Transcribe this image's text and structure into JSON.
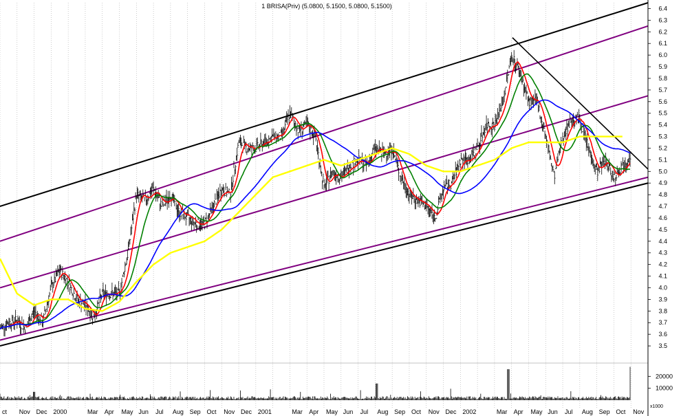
{
  "chart_data": {
    "type": "line",
    "title": "1 BRISA(Priv) (5.0800, 5.1500, 5.0800, 5.1500)",
    "ylim": [
      3.4,
      6.45
    ],
    "y_ticks": [
      "3.5",
      "3.6",
      "3.7",
      "3.8",
      "3.9",
      "4.0",
      "4.1",
      "4.2",
      "4.3",
      "4.4",
      "4.5",
      "4.6",
      "4.7",
      "4.8",
      "4.9",
      "5.0",
      "5.1",
      "5.2",
      "5.3",
      "5.4",
      "5.5",
      "5.6",
      "5.7",
      "5.8",
      "5.9",
      "6.0",
      "6.1",
      "6.2",
      "6.3",
      "6.4"
    ],
    "x_labels": [
      "ct",
      "Nov",
      "Dec",
      "2000",
      "Mar",
      "Apr",
      "May",
      "Jun",
      "Jul",
      "Aug",
      "Sep",
      "Oct",
      "Nov",
      "Dec",
      "2001",
      "Mar",
      "Apr",
      "May",
      "Jun",
      "Jul",
      "Aug",
      "Sep",
      "Oct",
      "Nov",
      "Dec",
      "2002",
      "Mar",
      "Apr",
      "May",
      "Jun",
      "Jul",
      "Aug",
      "Sep",
      "Oct",
      "Nov"
    ],
    "x_label_months": [
      0,
      1,
      2,
      3,
      5,
      6,
      7,
      8,
      9,
      10,
      11,
      12,
      13,
      14,
      15,
      17,
      18,
      19,
      20,
      21,
      22,
      23,
      24,
      25,
      26,
      27,
      29,
      30,
      31,
      32,
      33,
      34,
      35,
      36,
      37
    ],
    "months_total": 38,
    "volume_ticks": [
      "20000",
      "10000"
    ],
    "volume_unit": "x1000",
    "volume_ylim": [
      0,
      30000
    ],
    "price_anchors": [
      [
        0,
        3.65
      ],
      [
        0.5,
        3.7
      ],
      [
        1,
        3.72
      ],
      [
        1.5,
        3.65
      ],
      [
        2,
        3.8
      ],
      [
        2.5,
        3.7
      ],
      [
        3,
        4.0
      ],
      [
        3.5,
        4.15
      ],
      [
        4,
        4.05
      ],
      [
        4.5,
        3.9
      ],
      [
        5,
        3.85
      ],
      [
        5.5,
        3.75
      ],
      [
        6,
        3.95
      ],
      [
        6.5,
        3.95
      ],
      [
        7,
        3.95
      ],
      [
        7.5,
        4.3
      ],
      [
        8,
        4.8
      ],
      [
        8.5,
        4.75
      ],
      [
        9,
        4.85
      ],
      [
        9.5,
        4.7
      ],
      [
        10,
        4.8
      ],
      [
        10.5,
        4.65
      ],
      [
        11,
        4.6
      ],
      [
        11.5,
        4.55
      ],
      [
        12,
        4.55
      ],
      [
        12.5,
        4.7
      ],
      [
        13,
        4.85
      ],
      [
        13.5,
        4.8
      ],
      [
        14,
        5.25
      ],
      [
        14.5,
        5.2
      ],
      [
        15,
        5.2
      ],
      [
        15.5,
        5.25
      ],
      [
        16,
        5.3
      ],
      [
        16.5,
        5.3
      ],
      [
        17,
        5.5
      ],
      [
        17.5,
        5.35
      ],
      [
        18,
        5.4
      ],
      [
        18.5,
        5.3
      ],
      [
        19,
        4.85
      ],
      [
        19.5,
        5.0
      ],
      [
        20,
        4.95
      ],
      [
        20.5,
        5.05
      ],
      [
        21,
        5.1
      ],
      [
        21.5,
        5.05
      ],
      [
        22,
        5.2
      ],
      [
        22.5,
        5.15
      ],
      [
        23,
        5.2
      ],
      [
        23.5,
        4.95
      ],
      [
        24,
        4.8
      ],
      [
        24.5,
        4.75
      ],
      [
        25,
        4.7
      ],
      [
        25.5,
        4.6
      ],
      [
        26,
        4.85
      ],
      [
        26.5,
        4.9
      ],
      [
        27,
        5.1
      ],
      [
        27.5,
        5.1
      ],
      [
        28,
        5.2
      ],
      [
        28.5,
        5.4
      ],
      [
        29,
        5.4
      ],
      [
        29.5,
        5.6
      ],
      [
        30,
        6.0
      ],
      [
        30.5,
        5.85
      ],
      [
        31,
        5.6
      ],
      [
        31.5,
        5.6
      ],
      [
        32,
        5.3
      ],
      [
        32.5,
        4.95
      ],
      [
        33,
        5.3
      ],
      [
        33.5,
        5.45
      ],
      [
        34,
        5.45
      ],
      [
        34.5,
        5.2
      ],
      [
        35,
        5.0
      ],
      [
        35.5,
        5.1
      ],
      [
        36,
        4.95
      ],
      [
        36.5,
        5.05
      ],
      [
        37,
        5.15
      ]
    ],
    "ma_long_anchors": [
      [
        0,
        4.25
      ],
      [
        1,
        3.95
      ],
      [
        2,
        3.85
      ],
      [
        3,
        3.9
      ],
      [
        4,
        3.9
      ],
      [
        5,
        3.82
      ],
      [
        6,
        3.8
      ],
      [
        7,
        3.88
      ],
      [
        8,
        4.05
      ],
      [
        9,
        4.2
      ],
      [
        10,
        4.3
      ],
      [
        11,
        4.35
      ],
      [
        12,
        4.4
      ],
      [
        13,
        4.5
      ],
      [
        14,
        4.65
      ],
      [
        15,
        4.8
      ],
      [
        16,
        4.95
      ],
      [
        17,
        5.0
      ],
      [
        18,
        5.05
      ],
      [
        19,
        5.1
      ],
      [
        20,
        5.05
      ],
      [
        21,
        5.1
      ],
      [
        22,
        5.15
      ],
      [
        23,
        5.2
      ],
      [
        24,
        5.15
      ],
      [
        25,
        5.05
      ],
      [
        26,
        5.0
      ],
      [
        27,
        5.0
      ],
      [
        28,
        5.05
      ],
      [
        29,
        5.1
      ],
      [
        30,
        5.2
      ],
      [
        31,
        5.25
      ],
      [
        32,
        5.25
      ],
      [
        33,
        5.25
      ],
      [
        34,
        5.3
      ],
      [
        35,
        5.3
      ],
      [
        36,
        5.3
      ],
      [
        36.6,
        5.3
      ]
    ],
    "series": [
      {
        "values_ref": "price_anchors",
        "color": "#000000",
        "role": "ohlc-bars"
      },
      {
        "values_ref": "price_anchors",
        "color": "#ff0000",
        "smoothing": 3
      },
      {
        "values_ref": "price_anchors",
        "color": "#008000",
        "smoothing": 8
      },
      {
        "values_ref": "price_anchors",
        "color": "#0000ff",
        "smoothing": 22
      },
      {
        "values_ref": "ma_long_anchors",
        "color": "#ffff00",
        "smoothing": 0
      }
    ],
    "channel": {
      "black_upper": [
        [
          0,
          4.7
        ],
        [
          38,
          6.45
        ]
      ],
      "purple_1": [
        [
          0,
          4.4
        ],
        [
          38,
          6.25
        ]
      ],
      "purple_2": [
        [
          0,
          4.0
        ],
        [
          38,
          5.65
        ]
      ],
      "purple_3": [
        [
          0,
          3.55
        ],
        [
          38,
          4.95
        ]
      ],
      "black_lower": [
        [
          0,
          3.5
        ],
        [
          38,
          4.9
        ]
      ],
      "downtrend": [
        [
          30.05,
          6.15
        ],
        [
          38,
          5.02
        ]
      ]
    },
    "colors": {
      "channel_outer": "#000000",
      "channel_inner": "#800080",
      "grid": "#aaaaaa"
    },
    "grid": "vertical dotted"
  }
}
